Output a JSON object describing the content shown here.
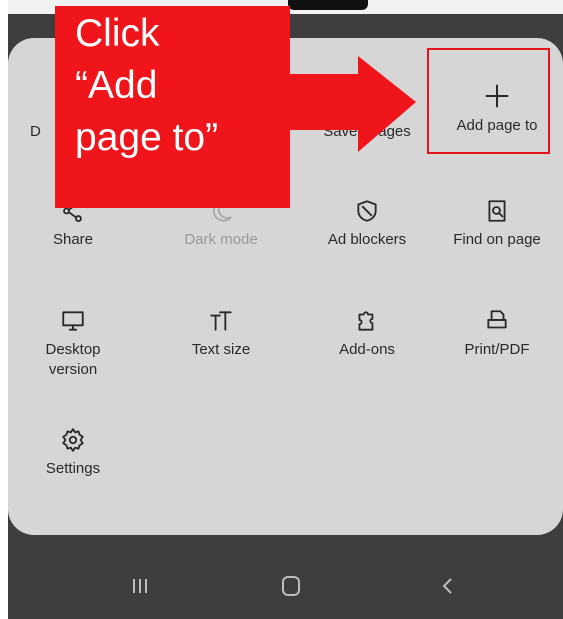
{
  "menu": {
    "row1": [
      {
        "label": "D",
        "icon": "download-icon"
      },
      {
        "label": "Saved pages",
        "icon": "saved-pages-icon"
      },
      {
        "label": "Add page to",
        "icon": "plus-icon"
      }
    ],
    "row2": [
      {
        "label": "Share",
        "icon": "share-icon"
      },
      {
        "label": "Dark mode",
        "icon": "moon-icon",
        "disabled": true
      },
      {
        "label": "Ad blockers",
        "icon": "shield-icon"
      },
      {
        "label": "Find on page",
        "icon": "find-icon"
      }
    ],
    "row3": [
      {
        "label": "Desktop version",
        "icon": "desktop-icon"
      },
      {
        "label": "Text size",
        "icon": "text-size-icon"
      },
      {
        "label": "Add-ons",
        "icon": "puzzle-icon"
      },
      {
        "label": "Print/PDF",
        "icon": "printer-icon"
      }
    ],
    "row4": [
      {
        "label": "Settings",
        "icon": "gear-icon"
      }
    ]
  },
  "callout": {
    "line1": "Click",
    "line2": "“Add",
    "line3": "page to”"
  },
  "navbar": {
    "recent": "recent-apps-icon",
    "home": "home-icon",
    "back": "back-icon"
  },
  "colors": {
    "callout": "#f0141b",
    "sheet": "#d6d6d6",
    "background": "#3e3e3e"
  }
}
